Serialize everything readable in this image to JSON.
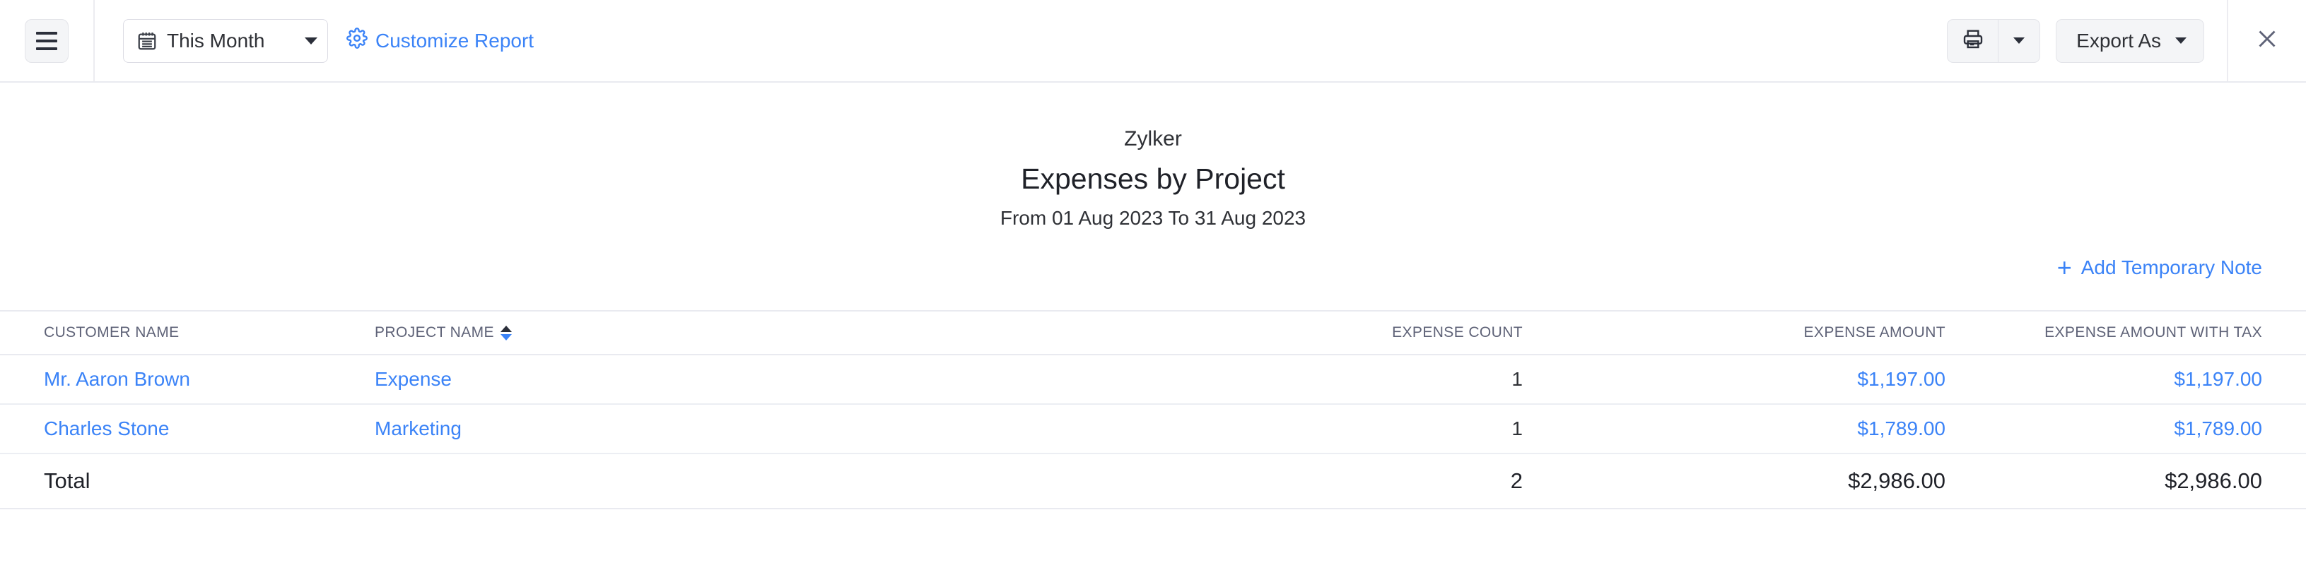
{
  "toolbar": {
    "menu_icon": "hamburger-icon",
    "date_filter": {
      "icon": "calendar-icon",
      "value": "This Month",
      "caret_icon": "chevron-down-icon"
    },
    "customize": {
      "icon": "gear-icon",
      "label": "Customize Report"
    },
    "print": {
      "icon": "printer-icon",
      "caret_icon": "chevron-down-icon"
    },
    "export": {
      "label": "Export As",
      "caret_icon": "chevron-down-icon"
    },
    "close_icon": "close-icon",
    "accent_color": "#3b83f7"
  },
  "report": {
    "organization": "Zylker",
    "title": "Expenses by Project",
    "date_range": "From 01 Aug 2023 To 31 Aug 2023",
    "add_note": {
      "plus": "+",
      "label": "Add Temporary Note"
    }
  },
  "table": {
    "columns": [
      {
        "label": "CUSTOMER NAME",
        "sortable": false
      },
      {
        "label": "PROJECT NAME",
        "sortable": true,
        "sort_icon": "sort-icon"
      },
      {
        "label": "EXPENSE COUNT",
        "sortable": false
      },
      {
        "label": "EXPENSE AMOUNT",
        "sortable": false
      },
      {
        "label": "EXPENSE AMOUNT WITH TAX",
        "sortable": false
      }
    ],
    "rows": [
      {
        "customer_name": "Mr. Aaron Brown",
        "project_name": "Expense",
        "expense_count": "1",
        "expense_amount": "$1,197.00",
        "expense_amount_with_tax": "$1,197.00"
      },
      {
        "customer_name": "Charles Stone",
        "project_name": "Marketing",
        "expense_count": "1",
        "expense_amount": "$1,789.00",
        "expense_amount_with_tax": "$1,789.00"
      }
    ],
    "total": {
      "label": "Total",
      "project_name": "",
      "expense_count": "2",
      "expense_amount": "$2,986.00",
      "expense_amount_with_tax": "$2,986.00"
    }
  }
}
